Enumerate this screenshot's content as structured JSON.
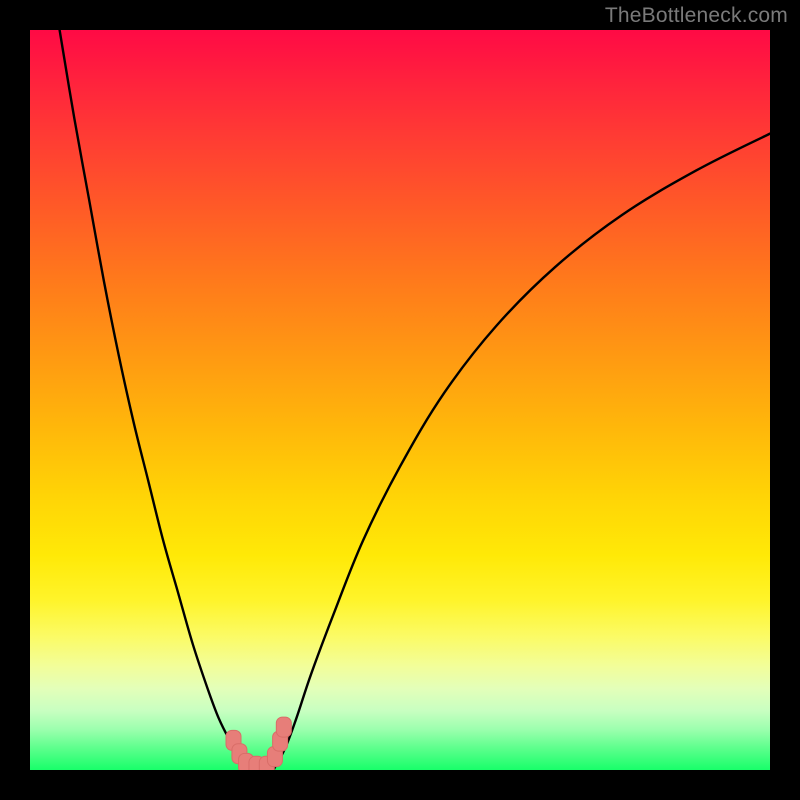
{
  "watermark": "TheBottleneck.com",
  "colors": {
    "frame": "#000000",
    "curve": "#000000",
    "marker_fill": "#e77e79",
    "marker_stroke": "#d96d68"
  },
  "chart_data": {
    "type": "line",
    "title": "",
    "xlabel": "",
    "ylabel": "",
    "xlim": [
      0,
      100
    ],
    "ylim": [
      0,
      100
    ],
    "grid": false,
    "legend": false,
    "annotations": [],
    "series": [
      {
        "name": "left-branch",
        "x": [
          4,
          6,
          8,
          10,
          12,
          14,
          16,
          18,
          20,
          22,
          24,
          25.5,
          27,
          28.5,
          29.5
        ],
        "y": [
          100,
          88,
          77,
          66,
          56,
          47,
          39,
          31,
          24,
          17,
          11,
          7,
          4,
          1.5,
          0.2
        ]
      },
      {
        "name": "right-branch",
        "x": [
          33,
          34.5,
          36,
          38,
          41,
          45,
          50,
          56,
          63,
          71,
          80,
          90,
          100
        ],
        "y": [
          0.2,
          3,
          7,
          13,
          21,
          31,
          41,
          51,
          60,
          68,
          75,
          81,
          86
        ]
      },
      {
        "name": "valley-floor",
        "x": [
          29.5,
          33
        ],
        "y": [
          0.2,
          0.2
        ]
      }
    ],
    "markers": [
      {
        "x": 27.5,
        "y": 4.0
      },
      {
        "x": 28.3,
        "y": 2.2
      },
      {
        "x": 29.2,
        "y": 0.9
      },
      {
        "x": 30.6,
        "y": 0.5
      },
      {
        "x": 32.0,
        "y": 0.5
      },
      {
        "x": 33.1,
        "y": 1.8
      },
      {
        "x": 33.8,
        "y": 3.9
      },
      {
        "x": 34.3,
        "y": 5.8
      }
    ]
  }
}
